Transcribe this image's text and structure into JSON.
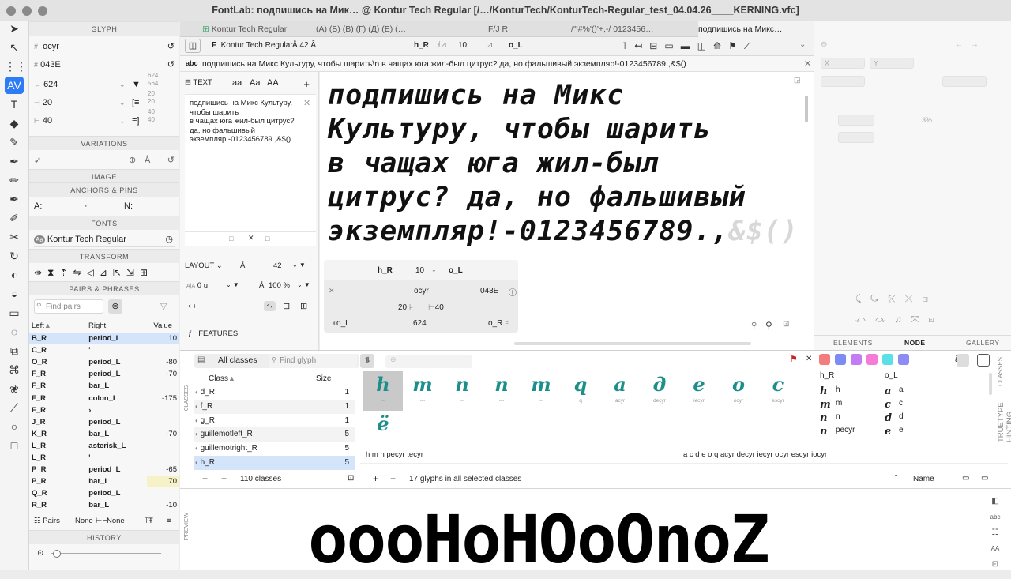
{
  "window": {
    "title": "FontLab: подпишись на Мик… @ Kontur Tech Regular [/…/KonturTech/KonturTech-Regular_test_04.04.26____KERNING.vfc]"
  },
  "tabs": [
    "Kontur Tech Regular",
    "(А) (Б) (В) (Г) (Д) (Е) (…",
    "F/J R",
    "/'\"#%'()'+,-/ 0123456…",
    "подпишись на Микс…"
  ],
  "glyph_panel": {
    "header": "GLYPH",
    "name": "ocyr",
    "unicode": "043E",
    "width": "624",
    "width_small": "624",
    "width_small2": "564",
    "lsb": "20",
    "lsb_small": "20",
    "lsb_small2": "20",
    "rsb": "40",
    "rsb_small": "40",
    "rsb_small2": "40"
  },
  "sections": {
    "variations": "VARIATIONS",
    "image": "IMAGE",
    "anchors": "ANCHORS & PINS",
    "fonts": "FONTS",
    "transform": "TRANSFORM",
    "pairs": "PAIRS & PHRASES",
    "history": "HISTORY"
  },
  "anchors": {
    "a": "A:",
    "dot": "·",
    "n": "N:"
  },
  "fonts": {
    "name": "Kontur Tech Regular"
  },
  "pairs": {
    "search_placeholder": "Find pairs",
    "col_left": "Left",
    "col_right": "Right",
    "col_value": "Value",
    "rows": [
      [
        "B_R",
        "period_L",
        "10"
      ],
      [
        "C_R",
        "'",
        ""
      ],
      [
        "O_R",
        "period_L",
        "-80"
      ],
      [
        "F_R",
        "period_L",
        "-70"
      ],
      [
        "F_R",
        "bar_L",
        ""
      ],
      [
        "F_R",
        "colon_L",
        "-175"
      ],
      [
        "F_R",
        "›",
        ""
      ],
      [
        "J_R",
        "period_L",
        ""
      ],
      [
        "K_R",
        "bar_L",
        "-70"
      ],
      [
        "L_R",
        "asterisk_L",
        ""
      ],
      [
        "L_R",
        "'",
        ""
      ],
      [
        "P_R",
        "period_L",
        "-65"
      ],
      [
        "P_R",
        "bar_L",
        "70"
      ],
      [
        "Q_R",
        "period_L",
        ""
      ],
      [
        "R_R",
        "bar_L",
        "-10"
      ]
    ],
    "footer_pairs": "Pairs",
    "footer_none1": "None",
    "footer_none2": "None"
  },
  "ctrl": {
    "font": "Kontur Tech Regular",
    "size": "42",
    "left": "h_R",
    "kern": "10",
    "right": "o_L"
  },
  "textbar": {
    "abc": "abc",
    "text": "подпишись на Микс Культуру, чтобы шарить\\n в чащах юга жил-был цитрус? да, но фальшивый экземпляр!-0123456789.,&$()"
  },
  "textpanel": {
    "label": "TEXT",
    "aa1": "aa",
    "aa2": "Aa",
    "aa3": "AA",
    "body": "подпишись на Микс Культуру, чтобы шарить\nв чащах юга жил-был цитрус? да, но фальшивый экземпляр!-0123456789.,&$()",
    "layout": "LAYOUT",
    "size": "42",
    "tracking": "0 u",
    "scale": "100 %",
    "features": "FEATURES"
  },
  "canvas": {
    "lines": [
      "подпишись на Микс",
      "Культуру, чтобы шарить",
      "в чащах юга жил-был",
      "цитрус? да, но фальшивый",
      "экземпляр!-0123456789.,"
    ],
    "tail": "&$()"
  },
  "kern_widget": {
    "left": "h_R",
    "value": "10",
    "right": "o_L",
    "glyph": "ocyr",
    "code": "043E",
    "lsb": "20",
    "rsb": "40",
    "lclass": "o_L",
    "width": "624",
    "rclass": "o_R"
  },
  "right_panel": {
    "x": "X",
    "y": "Y",
    "pct": "3%",
    "tabs": [
      "ELEMENTS",
      "NODE",
      "GALLERY"
    ]
  },
  "classes": {
    "all": "All classes",
    "find": "Find glyph",
    "col_class": "Class",
    "col_size": "Size",
    "rows": [
      [
        "d_R",
        "1"
      ],
      [
        "f_R",
        "1"
      ],
      [
        "g_R",
        "1"
      ],
      [
        "guillemotleft_R",
        "5"
      ],
      [
        "guillemotright_R",
        "5"
      ],
      [
        "h_R",
        "5"
      ]
    ],
    "count": "110 classes",
    "side": "CLASSES"
  },
  "glyphs": [
    {
      "ch": "h",
      "cap": "---"
    },
    {
      "ch": "m",
      "cap": "---"
    },
    {
      "ch": "n",
      "cap": "---"
    },
    {
      "ch": "n",
      "cap": "---"
    },
    {
      "ch": "m",
      "cap": "---"
    },
    {
      "ch": "q",
      "cap": "q"
    },
    {
      "ch": "a",
      "cap": "acyr"
    },
    {
      "ch": "д",
      "cap": "decyr"
    },
    {
      "ch": "е",
      "cap": "iecyr"
    },
    {
      "ch": "о",
      "cap": "ocyr"
    },
    {
      "ch": "с",
      "cap": "escyr"
    },
    {
      "ch": "ё",
      "cap": ""
    }
  ],
  "glyph_summary_left": "h m n pecyr tecyr",
  "glyph_summary_right": "a c d e o q acyr decyr iecyr ocyr escyr iocyr",
  "glyph_count": "17 glyphs in all selected classes",
  "sort": "Name",
  "class_map": {
    "left": "h_R",
    "right": "o_L",
    "rows": [
      [
        "h",
        "h",
        "a",
        "a"
      ],
      [
        "m",
        "m",
        "c",
        "c"
      ],
      [
        "n",
        "n",
        "d",
        "d"
      ],
      [
        "n",
        "pecyr",
        "e",
        "e"
      ]
    ]
  },
  "preview": {
    "label": "PREVIEW",
    "text": "oooHoHOoOnoZ",
    "side": "TRUETYPE HINTING",
    "side2": "CLASSES"
  },
  "colors": {
    "accent": "#2d7cf6",
    "glyph": "#1d8f8a",
    "selected_row": "#d4e4fb"
  }
}
